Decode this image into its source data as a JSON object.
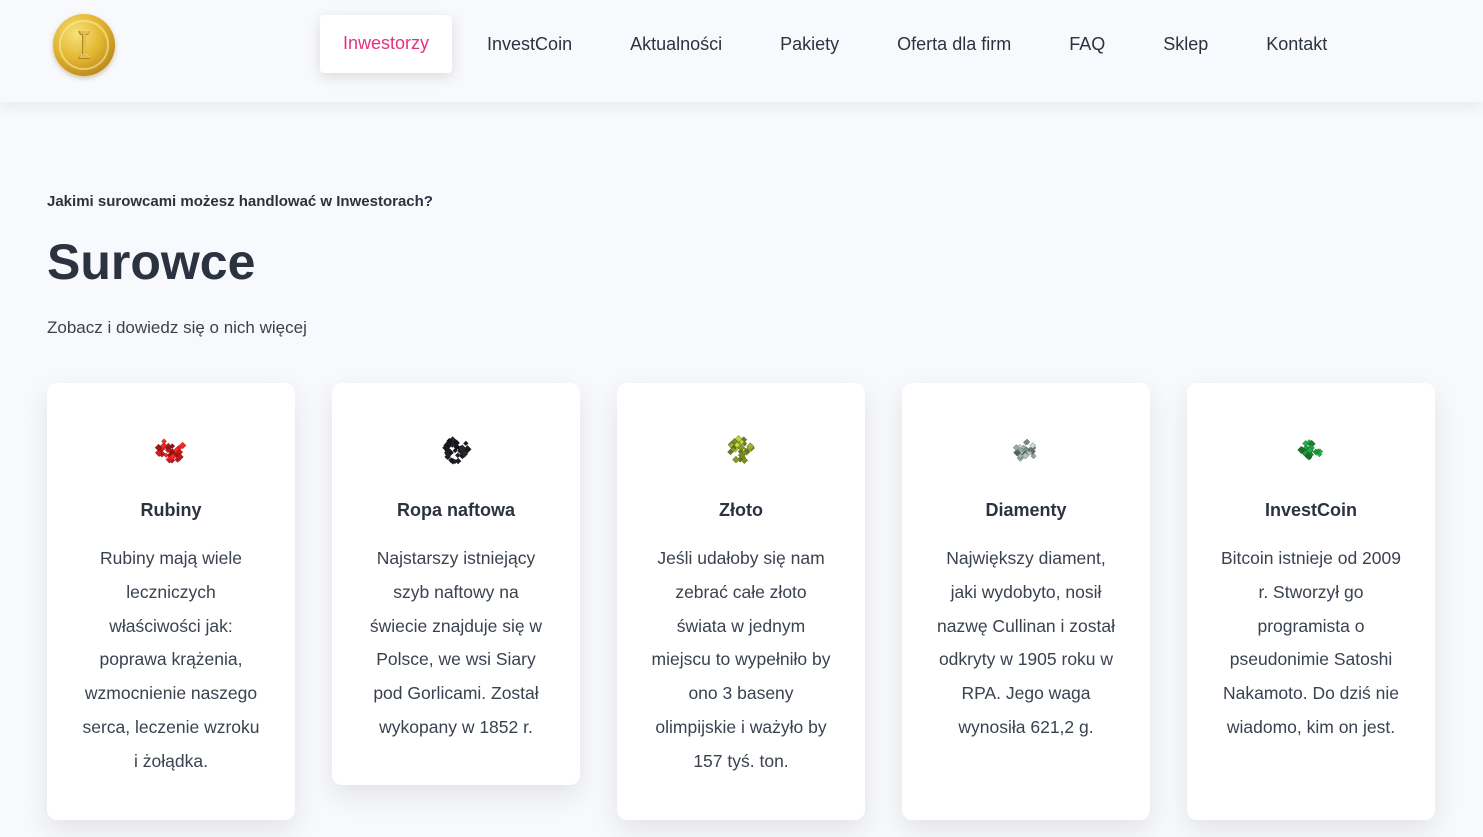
{
  "nav": {
    "items": [
      {
        "label": "Inwestorzy",
        "active": true
      },
      {
        "label": "InvestCoin"
      },
      {
        "label": "Aktualności"
      },
      {
        "label": "Pakiety"
      },
      {
        "label": "Oferta dla firm"
      },
      {
        "label": "FAQ"
      },
      {
        "label": "Sklep"
      },
      {
        "label": "Kontakt"
      }
    ],
    "active_color": "#e5317f"
  },
  "logo": {
    "icon": "gold-coin-logo-icon"
  },
  "section": {
    "eyebrow": "Jakimi surowcami możesz handlować w Inwestorach?",
    "title": "Surowce",
    "subtitle": "Zobacz i dowiedz się o nich więcej"
  },
  "cards": [
    {
      "title": "Rubiny",
      "icon": "ruby-gems-icon",
      "color": "#e02020",
      "text": "Rubiny mają wiele leczniczych właściwości jak: poprawa krążenia, wzmocnienie naszego serca, leczenie wzroku i żołądka."
    },
    {
      "title": "Ropa naftowa",
      "icon": "oil-gems-icon",
      "color": "#1c1c24",
      "text": "Najstarszy istniejący szyb naftowy na świecie znajduje się w Polsce, we wsi Siary pod Gorlicami. Został wykopany w 1852 r."
    },
    {
      "title": "Złoto",
      "icon": "gold-gems-icon",
      "color": "#8aa02a",
      "text": "Jeśli udałoby się nam zebrać całe złoto świata w jednym miejscu to wypełniło by ono 3 baseny olimpijskie i ważyło by 157 tyś. ton."
    },
    {
      "title": "Diamenty",
      "icon": "diamond-gems-icon",
      "color": "#8fa39a",
      "text": "Największy diament, jaki wydobyto, nosił nazwę Cullinan i został odkryty w 1905 roku w RPA. Jego waga wynosiła 621,2 g."
    },
    {
      "title": "InvestCoin",
      "icon": "investcoin-gems-icon",
      "color": "#1f9a3c",
      "text": "Bitcoin istnieje od 2009 r. Stworzył go programista o pseudonimie Satoshi Nakamoto. Do dziś nie wiadomo, kim on jest."
    }
  ]
}
